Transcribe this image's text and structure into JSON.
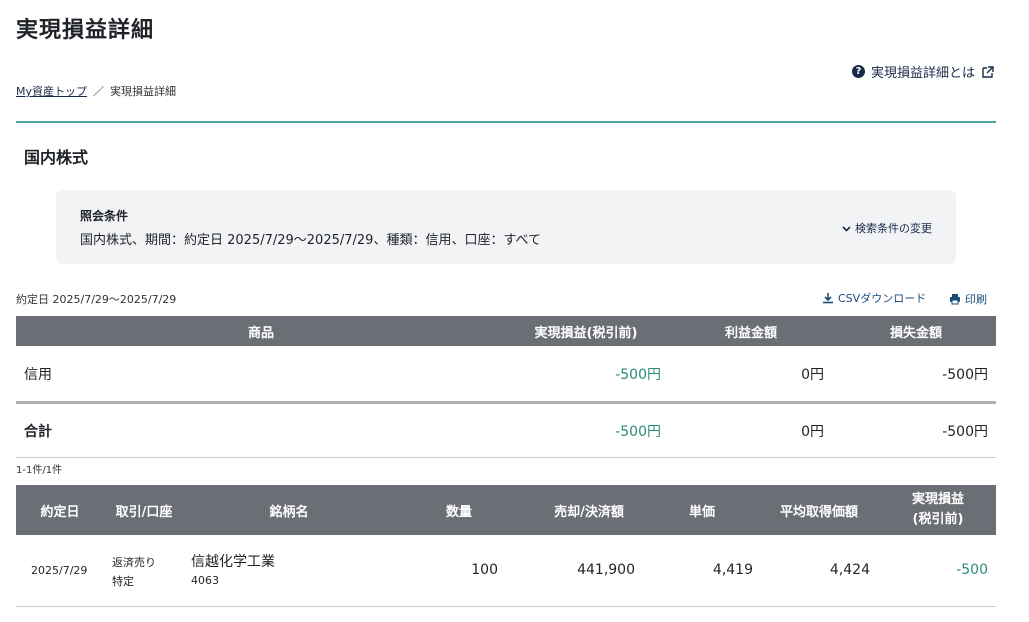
{
  "page_title": "実現損益詳細",
  "help_link": "実現損益詳細とは",
  "breadcrumb": {
    "home": "My資産トップ",
    "separator": "／",
    "current": "実現損益詳細"
  },
  "section_title": "国内株式",
  "conditions": {
    "label": "照会条件",
    "text": "国内株式、期間：約定日 2025/7/29〜2025/7/29、種類：信用、口座：すべて",
    "change_link": "検索条件の変更"
  },
  "period": "約定日 2025/7/29〜2025/7/29",
  "actions": {
    "csv": "CSVダウンロード",
    "print": "印刷"
  },
  "summary_table": {
    "headers": [
      "商品",
      "実現損益(税引前)",
      "利益金額",
      "損失金額"
    ],
    "rows": [
      {
        "product": "信用",
        "realized": "-500円",
        "profit": "0円",
        "loss": "-500円"
      }
    ],
    "total": {
      "label": "合計",
      "realized": "-500円",
      "profit": "0円",
      "loss": "-500円"
    }
  },
  "count_text": "1-1件/1件",
  "detail_table": {
    "headers": {
      "date": "約定日",
      "trade": "取引/口座",
      "name": "銘柄名",
      "qty": "数量",
      "amount": "売却/決済額",
      "price": "単価",
      "avg": "平均取得価額",
      "realized_1": "実現損益",
      "realized_2": "(税引前)"
    },
    "rows": [
      {
        "date": "2025/7/29",
        "trade": "返済売り",
        "account": "特定",
        "name": "信越化学工業",
        "code": "4063",
        "qty": "100",
        "amount": "441,900",
        "price": "4,419",
        "avg": "4,424",
        "realized": "-500"
      }
    ]
  },
  "colors": {
    "teal_rule": "#4aa6a6",
    "header_bg": "#6b6f75",
    "loss_text": "#2c8a7a",
    "link": "#1a2a4a"
  },
  "icons": [
    "help-icon",
    "external-link-icon",
    "chevron-down-icon",
    "download-icon",
    "print-icon"
  ]
}
